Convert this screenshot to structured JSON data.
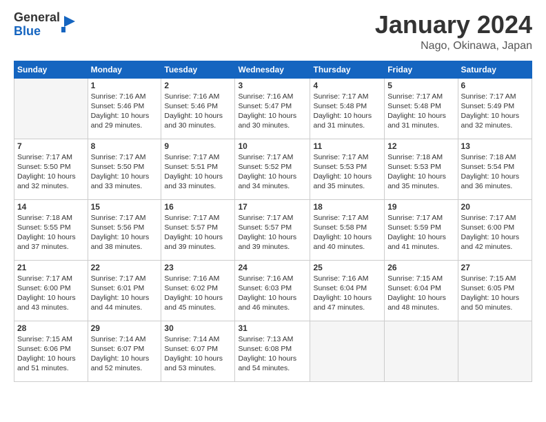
{
  "logo": {
    "general": "General",
    "blue": "Blue"
  },
  "header": {
    "title": "January 2024",
    "location": "Nago, Okinawa, Japan"
  },
  "days_of_week": [
    "Sunday",
    "Monday",
    "Tuesday",
    "Wednesday",
    "Thursday",
    "Friday",
    "Saturday"
  ],
  "weeks": [
    [
      {
        "day": "",
        "content": ""
      },
      {
        "day": "1",
        "content": "Sunrise: 7:16 AM\nSunset: 5:46 PM\nDaylight: 10 hours\nand 29 minutes."
      },
      {
        "day": "2",
        "content": "Sunrise: 7:16 AM\nSunset: 5:46 PM\nDaylight: 10 hours\nand 30 minutes."
      },
      {
        "day": "3",
        "content": "Sunrise: 7:16 AM\nSunset: 5:47 PM\nDaylight: 10 hours\nand 30 minutes."
      },
      {
        "day": "4",
        "content": "Sunrise: 7:17 AM\nSunset: 5:48 PM\nDaylight: 10 hours\nand 31 minutes."
      },
      {
        "day": "5",
        "content": "Sunrise: 7:17 AM\nSunset: 5:48 PM\nDaylight: 10 hours\nand 31 minutes."
      },
      {
        "day": "6",
        "content": "Sunrise: 7:17 AM\nSunset: 5:49 PM\nDaylight: 10 hours\nand 32 minutes."
      }
    ],
    [
      {
        "day": "7",
        "content": "Sunrise: 7:17 AM\nSunset: 5:50 PM\nDaylight: 10 hours\nand 32 minutes."
      },
      {
        "day": "8",
        "content": "Sunrise: 7:17 AM\nSunset: 5:50 PM\nDaylight: 10 hours\nand 33 minutes."
      },
      {
        "day": "9",
        "content": "Sunrise: 7:17 AM\nSunset: 5:51 PM\nDaylight: 10 hours\nand 33 minutes."
      },
      {
        "day": "10",
        "content": "Sunrise: 7:17 AM\nSunset: 5:52 PM\nDaylight: 10 hours\nand 34 minutes."
      },
      {
        "day": "11",
        "content": "Sunrise: 7:17 AM\nSunset: 5:53 PM\nDaylight: 10 hours\nand 35 minutes."
      },
      {
        "day": "12",
        "content": "Sunrise: 7:18 AM\nSunset: 5:53 PM\nDaylight: 10 hours\nand 35 minutes."
      },
      {
        "day": "13",
        "content": "Sunrise: 7:18 AM\nSunset: 5:54 PM\nDaylight: 10 hours\nand 36 minutes."
      }
    ],
    [
      {
        "day": "14",
        "content": "Sunrise: 7:18 AM\nSunset: 5:55 PM\nDaylight: 10 hours\nand 37 minutes."
      },
      {
        "day": "15",
        "content": "Sunrise: 7:17 AM\nSunset: 5:56 PM\nDaylight: 10 hours\nand 38 minutes."
      },
      {
        "day": "16",
        "content": "Sunrise: 7:17 AM\nSunset: 5:57 PM\nDaylight: 10 hours\nand 39 minutes."
      },
      {
        "day": "17",
        "content": "Sunrise: 7:17 AM\nSunset: 5:57 PM\nDaylight: 10 hours\nand 39 minutes."
      },
      {
        "day": "18",
        "content": "Sunrise: 7:17 AM\nSunset: 5:58 PM\nDaylight: 10 hours\nand 40 minutes."
      },
      {
        "day": "19",
        "content": "Sunrise: 7:17 AM\nSunset: 5:59 PM\nDaylight: 10 hours\nand 41 minutes."
      },
      {
        "day": "20",
        "content": "Sunrise: 7:17 AM\nSunset: 6:00 PM\nDaylight: 10 hours\nand 42 minutes."
      }
    ],
    [
      {
        "day": "21",
        "content": "Sunrise: 7:17 AM\nSunset: 6:00 PM\nDaylight: 10 hours\nand 43 minutes."
      },
      {
        "day": "22",
        "content": "Sunrise: 7:17 AM\nSunset: 6:01 PM\nDaylight: 10 hours\nand 44 minutes."
      },
      {
        "day": "23",
        "content": "Sunrise: 7:16 AM\nSunset: 6:02 PM\nDaylight: 10 hours\nand 45 minutes."
      },
      {
        "day": "24",
        "content": "Sunrise: 7:16 AM\nSunset: 6:03 PM\nDaylight: 10 hours\nand 46 minutes."
      },
      {
        "day": "25",
        "content": "Sunrise: 7:16 AM\nSunset: 6:04 PM\nDaylight: 10 hours\nand 47 minutes."
      },
      {
        "day": "26",
        "content": "Sunrise: 7:15 AM\nSunset: 6:04 PM\nDaylight: 10 hours\nand 48 minutes."
      },
      {
        "day": "27",
        "content": "Sunrise: 7:15 AM\nSunset: 6:05 PM\nDaylight: 10 hours\nand 50 minutes."
      }
    ],
    [
      {
        "day": "28",
        "content": "Sunrise: 7:15 AM\nSunset: 6:06 PM\nDaylight: 10 hours\nand 51 minutes."
      },
      {
        "day": "29",
        "content": "Sunrise: 7:14 AM\nSunset: 6:07 PM\nDaylight: 10 hours\nand 52 minutes."
      },
      {
        "day": "30",
        "content": "Sunrise: 7:14 AM\nSunset: 6:07 PM\nDaylight: 10 hours\nand 53 minutes."
      },
      {
        "day": "31",
        "content": "Sunrise: 7:13 AM\nSunset: 6:08 PM\nDaylight: 10 hours\nand 54 minutes."
      },
      {
        "day": "",
        "content": ""
      },
      {
        "day": "",
        "content": ""
      },
      {
        "day": "",
        "content": ""
      }
    ]
  ]
}
